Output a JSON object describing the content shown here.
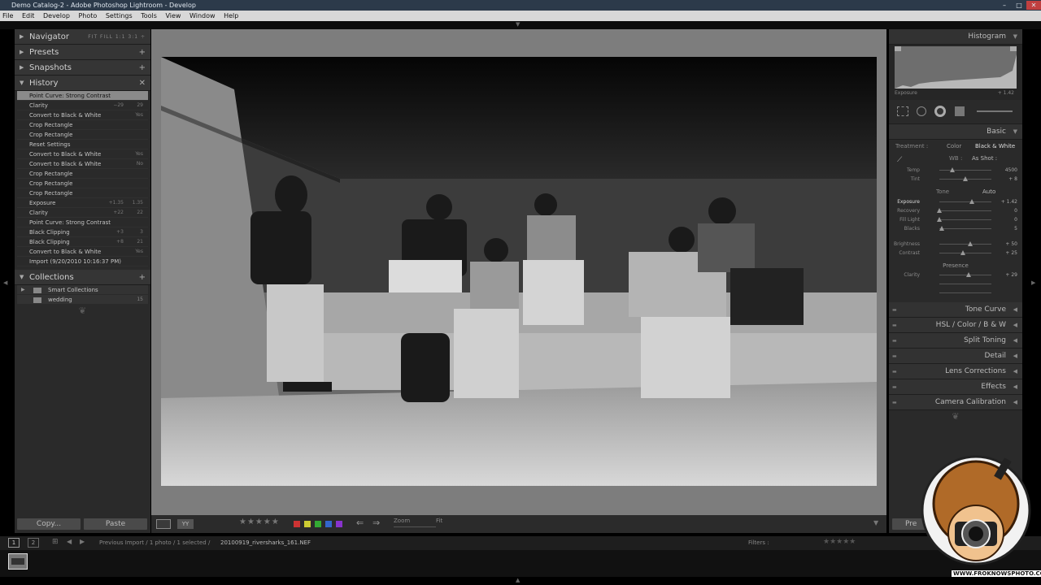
{
  "window": {
    "title": "Demo Catalog-2 - Adobe Photoshop Lightroom - Develop"
  },
  "menu": [
    "File",
    "Edit",
    "Develop",
    "Photo",
    "Settings",
    "Tools",
    "View",
    "Window",
    "Help"
  ],
  "left": {
    "navigator": {
      "label": "Navigator",
      "zoom_opts": "FIT  FILL  1:1  3:1 ÷"
    },
    "presets": {
      "label": "Presets"
    },
    "snapshots": {
      "label": "Snapshots"
    },
    "history": {
      "label": "History",
      "items": [
        {
          "name": "Point Curve: Strong Contrast",
          "v1": "",
          "v2": "",
          "selected": true
        },
        {
          "name": "Clarity",
          "v1": "−29",
          "v2": "29"
        },
        {
          "name": "Convert to Black & White",
          "v1": "",
          "v2": "Yes"
        },
        {
          "name": "Crop Rectangle",
          "v1": "",
          "v2": ""
        },
        {
          "name": "Crop Rectangle",
          "v1": "",
          "v2": ""
        },
        {
          "name": "Reset Settings",
          "v1": "",
          "v2": ""
        },
        {
          "name": "Convert to Black & White",
          "v1": "",
          "v2": "Yes"
        },
        {
          "name": "Convert to Black & White",
          "v1": "",
          "v2": "No"
        },
        {
          "name": "Crop Rectangle",
          "v1": "",
          "v2": ""
        },
        {
          "name": "Crop Rectangle",
          "v1": "",
          "v2": ""
        },
        {
          "name": "Crop Rectangle",
          "v1": "",
          "v2": ""
        },
        {
          "name": "Exposure",
          "v1": "+1.35",
          "v2": "1.35"
        },
        {
          "name": "Clarity",
          "v1": "+22",
          "v2": "22"
        },
        {
          "name": "Point Curve: Strong Contrast",
          "v1": "",
          "v2": ""
        },
        {
          "name": "Black Clipping",
          "v1": "+3",
          "v2": "3"
        },
        {
          "name": "Black Clipping",
          "v1": "+8",
          "v2": "21"
        },
        {
          "name": "Convert to Black & White",
          "v1": "",
          "v2": "Yes"
        },
        {
          "name": "Import (9/20/2010 10:16:37 PM)",
          "v1": "",
          "v2": ""
        }
      ]
    },
    "collections": {
      "label": "Collections",
      "items": [
        {
          "name": "Smart Collections",
          "count": ""
        },
        {
          "name": "wedding",
          "count": "15"
        }
      ]
    },
    "copy_label": "Copy...",
    "paste_label": "Paste"
  },
  "toolbar": {
    "zoom_label": "Zoom",
    "fit_label": "Fit",
    "stars": "★★★★★"
  },
  "filmstrip": {
    "page1": "1",
    "page2": "2",
    "source_text": "Previous Import / 1 photo / 1 selected /",
    "filename": "20100919_riversharks_161.NEF",
    "filters_label": "Filters :"
  },
  "right": {
    "histogram": {
      "label": "Histogram",
      "exposure_label": "Exposure",
      "exposure_value": "+ 1.42"
    },
    "basic": {
      "label": "Basic",
      "treatment_label": "Treatment :",
      "treatment_color": "Color",
      "treatment_bw": "Black & White",
      "wb_label": "WB :",
      "wb_value": "As Shot :",
      "temp_label": "Temp",
      "temp_value": "4500",
      "tint_label": "Tint",
      "tint_value": "+ 8",
      "tone_label": "Tone",
      "auto_label": "Auto",
      "sliders": [
        {
          "label": "Exposure",
          "value": "+ 1.42",
          "pos": 0.62
        },
        {
          "label": "Recovery",
          "value": "0",
          "pos": 0.0
        },
        {
          "label": "Fill Light",
          "value": "0",
          "pos": 0.0
        },
        {
          "label": "Blacks",
          "value": "5",
          "pos": 0.05
        }
      ],
      "sliders2": [
        {
          "label": "Brightness",
          "value": "+ 50",
          "pos": 0.6
        },
        {
          "label": "Contrast",
          "value": "+ 25",
          "pos": 0.45
        }
      ],
      "presence_label": "Presence",
      "clarity_label": "Clarity",
      "clarity_value": "+ 29",
      "clarity_pos": 0.57
    },
    "panels": [
      {
        "label": "Tone Curve"
      },
      {
        "label": "HSL  /  Color  /  B & W"
      },
      {
        "label": "Split Toning"
      },
      {
        "label": "Detail"
      },
      {
        "label": "Lens Corrections"
      },
      {
        "label": "Effects"
      },
      {
        "label": "Camera Calibration"
      }
    ],
    "prev_label": "Pre"
  },
  "logo": {
    "text": "WWW.FROKNOWSPHOTO.COM"
  }
}
